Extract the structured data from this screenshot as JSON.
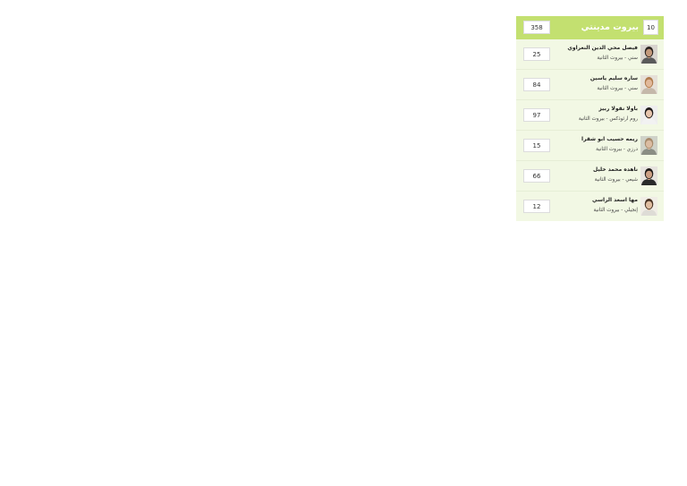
{
  "list": {
    "number": "10",
    "name": "بيروت مدينتي",
    "total_votes": "358"
  },
  "candidates": [
    {
      "name": "فيصل محي الدين النعراوي",
      "subtitle": "سني - بيروت الثانية",
      "votes": "25",
      "hair": "#2b2420",
      "skin": "#c49a7c",
      "shirt": "#5a5a5a",
      "bg": "#d8d4ce"
    },
    {
      "name": "ساره سليم ياسين",
      "subtitle": "سني - بيروت الثانية",
      "votes": "84",
      "hair": "#b07c4e",
      "skin": "#e2b99b",
      "shirt": "#c5b8aa",
      "bg": "#e6e0d8"
    },
    {
      "name": "باولا نقولا ربيز",
      "subtitle": "روم ارثوذكس - بيروت الثانية",
      "votes": "97",
      "hair": "#1e1a1a",
      "skin": "#e6c4ad",
      "shirt": "#f2f2f2",
      "bg": "#eeeeee"
    },
    {
      "name": "ريمه حسيب ابو شقرا",
      "subtitle": "درزي - بيروت الثانية",
      "votes": "15",
      "hair": "#a78b6c",
      "skin": "#dbbca2",
      "shirt": "#8a8d84",
      "bg": "#cfd2c8"
    },
    {
      "name": "ناهده محمد خليل",
      "subtitle": "شيعي - بيروت الثانية",
      "votes": "66",
      "hair": "#1f1a18",
      "skin": "#cc9f84",
      "shirt": "#2a2a2a",
      "bg": "#e6e3de"
    },
    {
      "name": "مها اسعد الراسي",
      "subtitle": "إنجيلي - بيروت الثانية",
      "votes": "12",
      "hair": "#4a3426",
      "skin": "#e0bda1",
      "shirt": "#dedcd6",
      "bg": "#f0ede6"
    }
  ]
}
